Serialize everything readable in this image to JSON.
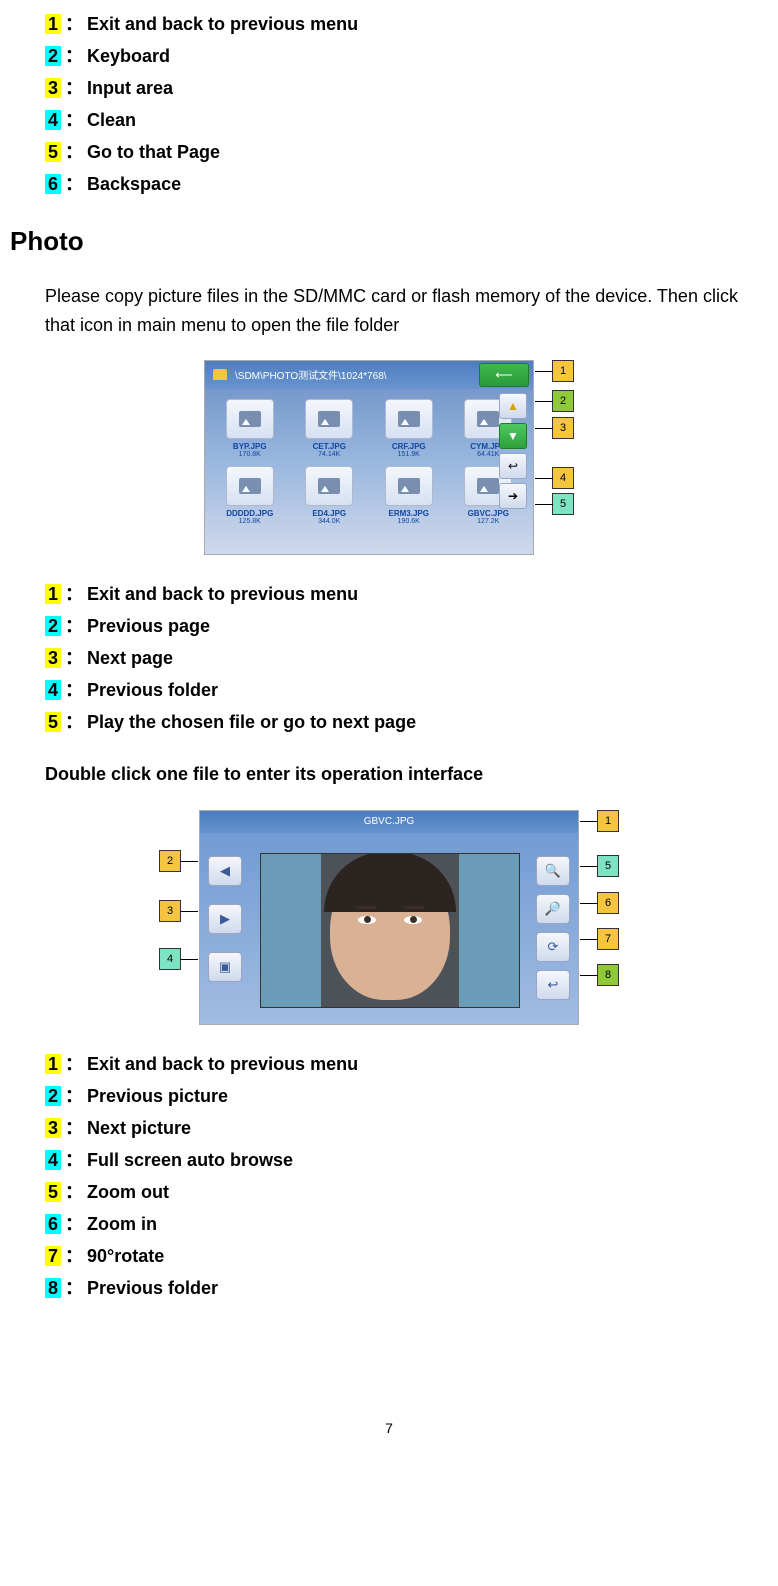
{
  "list1": [
    {
      "n": "1",
      "hl": "hl-yellow",
      "t": "Exit and back to previous menu"
    },
    {
      "n": "2",
      "hl": "hl-cyan",
      "t": "Keyboard"
    },
    {
      "n": "3",
      "hl": "hl-yellow",
      "t": "Input area"
    },
    {
      "n": "4",
      "hl": "hl-cyan",
      "t": "Clean"
    },
    {
      "n": "5",
      "hl": "hl-yellow",
      "t": "Go to that Page"
    },
    {
      "n": "6",
      "hl": "hl-cyan",
      "t": "Backspace"
    }
  ],
  "heading": "Photo",
  "para": "Please copy picture files in the SD/MMC card or flash memory of the device. Then click that icon in main menu to open the file folder",
  "shot1": {
    "path": "\\SDM\\PHOTO测试文件\\1024*768\\",
    "files": [
      {
        "n": "BYP.JPG",
        "s": "170.8K"
      },
      {
        "n": "CET.JPG",
        "s": "74.14K"
      },
      {
        "n": "CRF.JPG",
        "s": "151.9K"
      },
      {
        "n": "CYM.JPG",
        "s": "64.41K"
      },
      {
        "n": "DDDDD.JPG",
        "s": "125.8K"
      },
      {
        "n": "ED4.JPG",
        "s": "344.0K"
      },
      {
        "n": "ERM3.JPG",
        "s": "190.6K"
      },
      {
        "n": "GBVC.JPG",
        "s": "127.2K"
      }
    ],
    "callouts": [
      "1",
      "2",
      "3",
      "4",
      "5"
    ]
  },
  "list2": [
    {
      "n": "1",
      "hl": "hl-yellow",
      "t": "Exit and back to previous menu"
    },
    {
      "n": "2",
      "hl": "hl-cyan",
      "t": "Previous page"
    },
    {
      "n": "3",
      "hl": "hl-yellow",
      "t": "Next page"
    },
    {
      "n": "4",
      "hl": "hl-cyan",
      "t": "Previous folder"
    },
    {
      "n": "5",
      "hl": "hl-yellow",
      "t": "Play the chosen file or go to next page"
    }
  ],
  "note2": "Double click one file to enter its operation interface",
  "shot2": {
    "title": "GBVC.JPG",
    "callouts_left": [
      "2",
      "3",
      "4"
    ],
    "callouts_right": [
      "1",
      "5",
      "6",
      "7",
      "8"
    ]
  },
  "list3": [
    {
      "n": "1",
      "hl": "hl-yellow",
      "t": "Exit and back to previous menu"
    },
    {
      "n": "2",
      "hl": "hl-cyan",
      "t": "Previous picture"
    },
    {
      "n": "3",
      "hl": "hl-yellow",
      "t": "Next picture"
    },
    {
      "n": "4",
      "hl": "hl-cyan",
      "t": "Full screen auto browse"
    },
    {
      "n": "5",
      "hl": "hl-yellow",
      "t": "Zoom out"
    },
    {
      "n": "6",
      "hl": "hl-cyan",
      "t": "Zoom in"
    },
    {
      "n": "7",
      "hl": "hl-yellow",
      "t": "90°rotate"
    },
    {
      "n": "8",
      "hl": "hl-cyan",
      "t": "Previous folder"
    }
  ],
  "pagenum": "7"
}
